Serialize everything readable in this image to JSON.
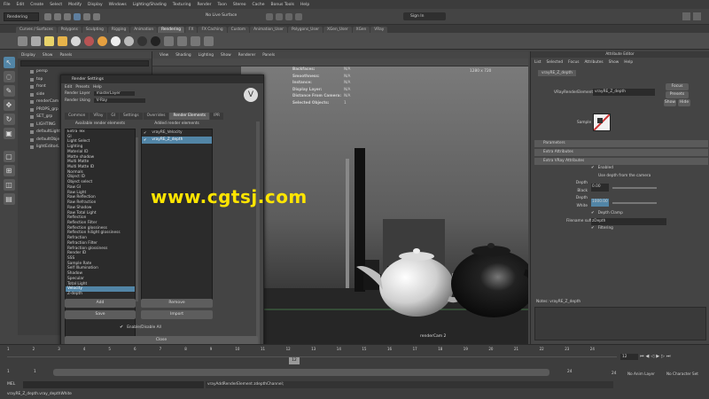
{
  "menus": [
    "File",
    "Edit",
    "Create",
    "Select",
    "Modify",
    "Display",
    "Windows",
    "Lighting/Shading",
    "Texturing",
    "Render",
    "Toon",
    "Stereo",
    "Cache",
    "Bonus Tools",
    "Help"
  ],
  "menuset": "Rendering",
  "surface": "No Live Surface",
  "signin": "Sign In",
  "shelf_tabs": [
    "Curves / Surfaces",
    "Polygons",
    "Sculpting",
    "Rigging",
    "Animation",
    "Rendering",
    "FX",
    "FX Caching",
    "Custom",
    "Animation_User",
    "Polygons_User",
    "XGen_User",
    "XGen",
    "VRay"
  ],
  "shelf_active": "Rendering",
  "outliner": {
    "menus": [
      "Display",
      "Show",
      "Panels"
    ],
    "items": [
      "persp",
      "top",
      "front",
      "side",
      "renderCam",
      "PROPS_grp",
      "SET_grp",
      "LIGHTING",
      "defaultLight",
      "defaultObje",
      "lightEditorL"
    ]
  },
  "viewport": {
    "menus": [
      "View",
      "Shading",
      "Lighting",
      "Show",
      "Renderer",
      "Panels"
    ],
    "resolution": "1280 x 720",
    "camera": "renderCam 2",
    "hud": [
      [
        "Backfaces:",
        "N/A"
      ],
      [
        "Smoothness:",
        "N/A"
      ],
      [
        "Instance:",
        "N/A"
      ],
      [
        "Display Layer:",
        "N/A"
      ],
      [
        "Distance From Camera:",
        "N/A"
      ],
      [
        "Selected Objects:",
        "1"
      ]
    ]
  },
  "render_settings": {
    "title": "Render Settings",
    "menus": [
      "Edit",
      "Presets",
      "Help"
    ],
    "layer_label": "Render Layer",
    "layer_value": "masterLayer",
    "using_label": "Render Using",
    "using_value": "V-Ray",
    "tabs": [
      "Common",
      "VRay",
      "GI",
      "Settings",
      "Overrides",
      "Render Elements",
      "IPR"
    ],
    "active_tab": "Render Elements",
    "avail_header": "Available render elements",
    "added_header": "Added render elements",
    "available": [
      "Extra Tex",
      "GI",
      "Light Select",
      "Lighting",
      "Material ID",
      "Matte shadow",
      "Multi Matte",
      "Multi Matte ID",
      "Normals",
      "Object ID",
      "Object select",
      "Raw GI",
      "Raw Light",
      "Raw Reflection",
      "Raw Refraction",
      "Raw Shadow",
      "Raw Total Light",
      "Reflection",
      "Reflection Filter",
      "Reflection glossiness",
      "Reflection hilight glossiness",
      "Refraction",
      "Refraction Filter",
      "Refraction glossiness",
      "Render ID",
      "SSS",
      "Sample Rate",
      "Self Illumination",
      "Shadow",
      "Specular",
      "Total Light",
      "Velocity",
      "Z-depth"
    ],
    "selected_available": "Velocity",
    "added": [
      "vrayRE_Velocity",
      "vrayRE_Z_depth"
    ],
    "buttons": {
      "add": "Add",
      "remove": "Remove",
      "save": "Save",
      "import": "Import",
      "close": "Close"
    },
    "enable_label": "Enable/Disable All"
  },
  "attr": {
    "title": "Attribute Editor",
    "menus": [
      "List",
      "Selected",
      "Focus",
      "Attributes",
      "Show",
      "Help"
    ],
    "node_tab": "vrayRE_Z_depth",
    "node_label": "VRayRenderElement",
    "node_value": "vrayRE_Z_depth",
    "focus": "Focus",
    "presets": "Presets",
    "show": "Show",
    "hide": "Hide",
    "sample": "Sample",
    "sections": [
      "Parameters",
      "Extra Attributes",
      "Extra VRay Attributes"
    ],
    "enabled": "Enabled",
    "use_depth": "Use depth from the camera",
    "depth_black_label": "Depth Black",
    "depth_black": "0.00",
    "depth_white_label": "Depth White",
    "depth_white": "1000.00",
    "clamp": "Depth Clamp",
    "suffix_label": "Filename suffix",
    "suffix": "zDepth",
    "filtering": "Filtering",
    "notes": "Notes: vrayRE_Z_depth",
    "select": "Select",
    "load": "Load Attributes",
    "copy": "Copy Tab"
  },
  "timeline": {
    "ticks": [
      "1",
      "2",
      "3",
      "4",
      "5",
      "6",
      "7",
      "8",
      "9",
      "10",
      "11",
      "12",
      "13",
      "14",
      "15",
      "16",
      "17",
      "18",
      "19",
      "20",
      "21",
      "22",
      "23",
      "24"
    ],
    "current": "12",
    "start": "1",
    "end": "24",
    "range_start": "1",
    "range_end": "24",
    "anim_layer": "No Anim Layer",
    "char_set": "No Character Set"
  },
  "command": {
    "lang": "MEL",
    "text": "vrayAddRenderElement zdepthChannel;",
    "status": "vrayRE_Z_depth.vray_depthWhite"
  },
  "watermark": "www.cgtsj.com",
  "colors": {
    "selection": "#5285a6",
    "watermark": "#ffe500"
  }
}
